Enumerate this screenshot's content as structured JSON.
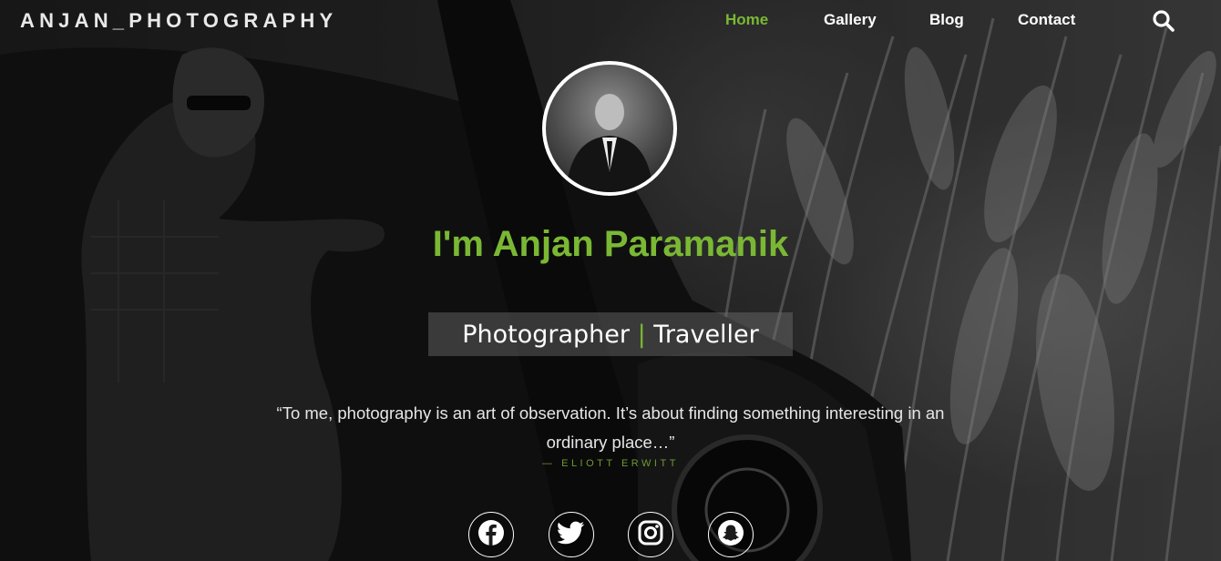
{
  "header": {
    "brand": "ANJAN_PHOTOGRAPHY",
    "nav": [
      {
        "label": "Home",
        "active": true
      },
      {
        "label": "Gallery",
        "active": false
      },
      {
        "label": "Blog",
        "active": false
      },
      {
        "label": "Contact",
        "active": false
      }
    ],
    "search_icon": "search-icon"
  },
  "hero": {
    "headline": "I'm Anjan Paramanik",
    "subtitle_left": "Photographer",
    "subtitle_sep": "|",
    "subtitle_right": "Traveller",
    "quote": "“To me, photography is an art of observation. It’s about finding something interesting in an ordinary place…”",
    "author": "— ELIOTT ERWITT"
  },
  "socials": [
    {
      "icon": "facebook-icon"
    },
    {
      "icon": "twitter-icon"
    },
    {
      "icon": "instagram-icon"
    },
    {
      "icon": "snapchat-icon"
    }
  ],
  "colors": {
    "accent": "#7ab834",
    "text": "#ffffff"
  }
}
